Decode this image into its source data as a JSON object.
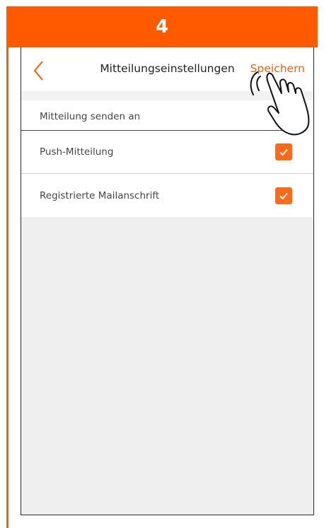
{
  "banner": {
    "step_number": "4"
  },
  "nav": {
    "back_icon": "chevron-left-icon",
    "title": "Mitteilungseinstellungen",
    "save_label": "Speichern"
  },
  "settings": {
    "section_label": "Mitteilung senden an",
    "items": [
      {
        "label": "Push-Mitteilung",
        "checked": true
      },
      {
        "label": "Registrierte Mailanschrift",
        "checked": true
      }
    ]
  },
  "colors": {
    "accent": "#ff5a00",
    "checkbox": "#ff6a1a",
    "background": "#efefef"
  }
}
